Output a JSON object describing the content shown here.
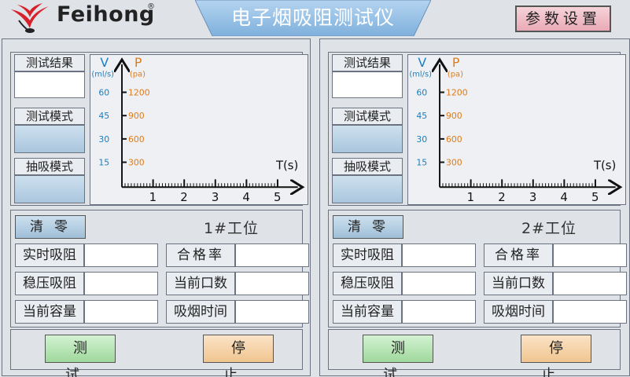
{
  "header": {
    "brand": "Feihong",
    "registered": "®",
    "title": "电子烟吸阻测试仪",
    "params_button": "参数设置"
  },
  "colors": {
    "v_axis": "#1a7fc1",
    "p_axis": "#e07b1a",
    "title_tab": "#9ec5e8",
    "logo_red": "#d8202a"
  },
  "panels": [
    {
      "result_label": "测试结果",
      "mode_label": "测试模式",
      "suction_label": "抽吸模式",
      "chart": {
        "v_title": "V",
        "v_unit": "(ml/s)",
        "p_title": "P",
        "p_unit": "(pa)",
        "t_label": "T(s)",
        "v_ticks": [
          "60",
          "45",
          "30",
          "15"
        ],
        "p_ticks": [
          "1200",
          "900",
          "600",
          "300"
        ],
        "x_ticks": [
          "1",
          "2",
          "3",
          "4",
          "5"
        ]
      },
      "clear_button": "清零",
      "station": "1#工位",
      "fields": [
        {
          "label": "实时吸阻",
          "value": ""
        },
        {
          "label": "合格率",
          "value": ""
        },
        {
          "label": "稳压吸阻",
          "value": ""
        },
        {
          "label": "当前口数",
          "value": ""
        },
        {
          "label": "当前容量",
          "value": ""
        },
        {
          "label": "吸烟时间",
          "value": ""
        }
      ],
      "test_button": "测试",
      "stop_button": "停止"
    },
    {
      "result_label": "测试结果",
      "mode_label": "测试模式",
      "suction_label": "抽吸模式",
      "chart": {
        "v_title": "V",
        "v_unit": "(ml/s)",
        "p_title": "P",
        "p_unit": "(pa)",
        "t_label": "T(s)",
        "v_ticks": [
          "60",
          "45",
          "30",
          "15"
        ],
        "p_ticks": [
          "1200",
          "900",
          "600",
          "300"
        ],
        "x_ticks": [
          "1",
          "2",
          "3",
          "4",
          "5"
        ]
      },
      "clear_button": "清零",
      "station": "2#工位",
      "fields": [
        {
          "label": "实时吸阻",
          "value": ""
        },
        {
          "label": "合格率",
          "value": ""
        },
        {
          "label": "稳压吸阻",
          "value": ""
        },
        {
          "label": "当前口数",
          "value": ""
        },
        {
          "label": "当前容量",
          "value": ""
        },
        {
          "label": "吸烟时间",
          "value": ""
        }
      ],
      "test_button": "测试",
      "stop_button": "停止"
    }
  ]
}
